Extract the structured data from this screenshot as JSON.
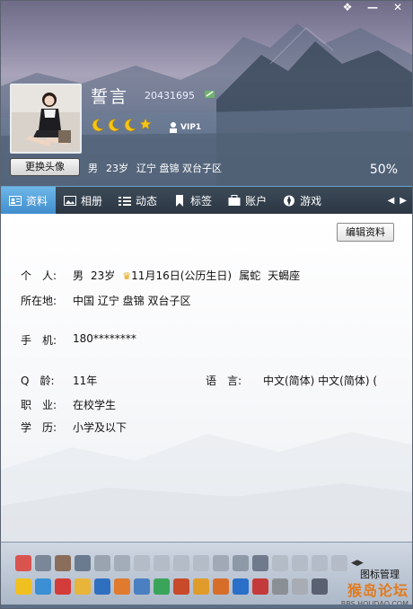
{
  "header": {
    "nickname": "誓言",
    "qq_number": "20431695",
    "vip_label": "VIP1",
    "change_avatar_label": "更换头像",
    "gender": "男",
    "age": "23岁",
    "location": "辽宁 盘锦 双台子区",
    "completion": "50%"
  },
  "tabs": [
    {
      "label": "资料",
      "icon": "profile-card-icon"
    },
    {
      "label": "相册",
      "icon": "photo-album-icon"
    },
    {
      "label": "动态",
      "icon": "feed-icon"
    },
    {
      "label": "标签",
      "icon": "bookmark-icon"
    },
    {
      "label": "账户",
      "icon": "wallet-icon"
    },
    {
      "label": "游戏",
      "icon": "game-icon"
    }
  ],
  "profile": {
    "edit_label": "编辑资料",
    "person_label": "个　人:",
    "gender": "男",
    "age": "23岁",
    "birthday": "11月16日(公历生日)",
    "zodiac": "属蛇",
    "sign": "天蝎座",
    "location_label": "所在地:",
    "location": "中国 辽宁 盘锦 双台子区",
    "phone_label": "手　机:",
    "phone": "180********",
    "qage_label": "Q　龄:",
    "qage": "11年",
    "language_label": "语　言:",
    "languages": "中文(简体)  中文(简体)  (",
    "job_label": "职　业:",
    "job": "在校学生",
    "edu_label": "学　历:",
    "edu": "小学及以下"
  },
  "iconbar": {
    "manage_label": "图标管理",
    "watermark_main": "猴岛论坛",
    "watermark_sub": "BBS.HOUDAO.COM"
  },
  "colors": {
    "tab_active": "#3e8ccd",
    "tab_bar": "#2b3642",
    "accent_gold": "#e6a400"
  }
}
